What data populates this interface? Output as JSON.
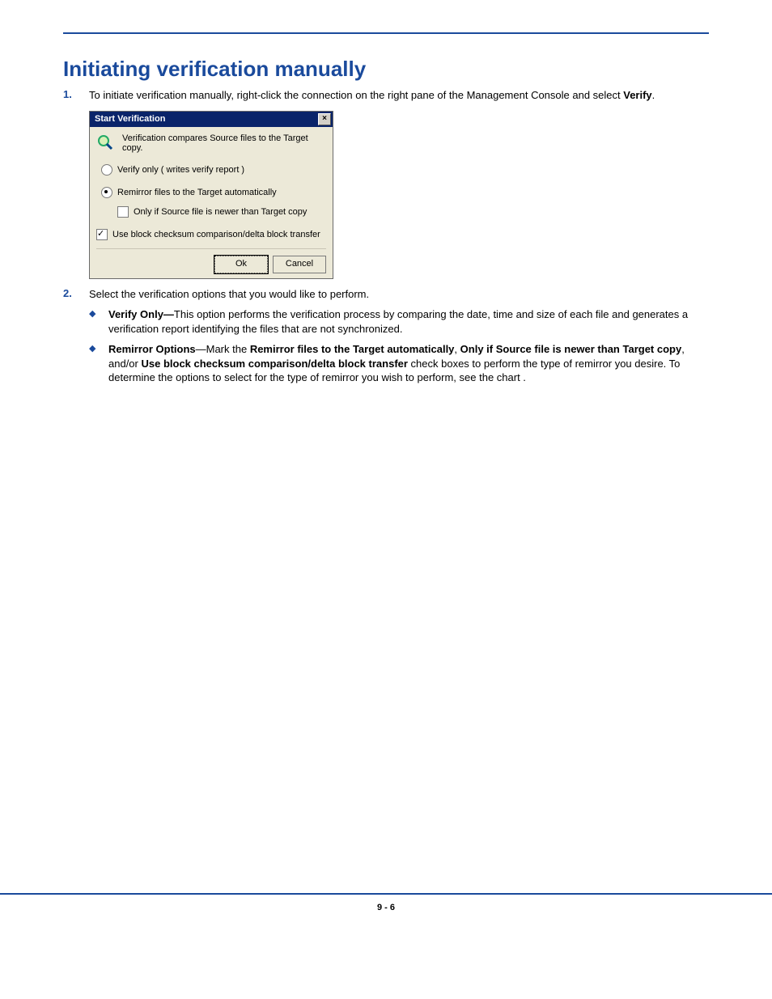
{
  "heading": "Initiating verification manually",
  "steps": [
    {
      "num": "1.",
      "pre": "To initiate verification manually, right-click the connection on the right pane of the Management Console and select ",
      "bold": "Verify",
      "post": "."
    },
    {
      "num": "2.",
      "text": "Select the verification options that you would like to perform."
    }
  ],
  "dialog": {
    "title": "Start Verification",
    "desc": "Verification compares Source files to the Target copy.",
    "radio_verify": "Verify only ( writes verify report )",
    "radio_remirror": "Remirror files to the Target automatically",
    "chk_only_newer": "Only if Source file is newer than Target copy",
    "chk_block": "Use block checksum comparison/delta block transfer",
    "ok": "Ok",
    "cancel": "Cancel"
  },
  "bullets": [
    {
      "lead_bold": "Verify Only—",
      "rest": "This option performs the verification process by comparing the date, time and size of each file and generates a verification report identifying the files that are not synchronized."
    },
    {
      "lead_bold": "Remirror Options",
      "dash": "—Mark the ",
      "b1": "Remirror files to the Target automatically",
      "m1": ", ",
      "b2": "Only if Source file is newer than Target copy",
      "m2": ", and/or ",
      "b3": "Use block checksum comparison/delta block transfer",
      "tail": " check boxes to perform the type of remirror you desire. To determine the options to select for the type of remirror you wish to perform, see the chart ."
    }
  ],
  "page_number": "9 - 6"
}
